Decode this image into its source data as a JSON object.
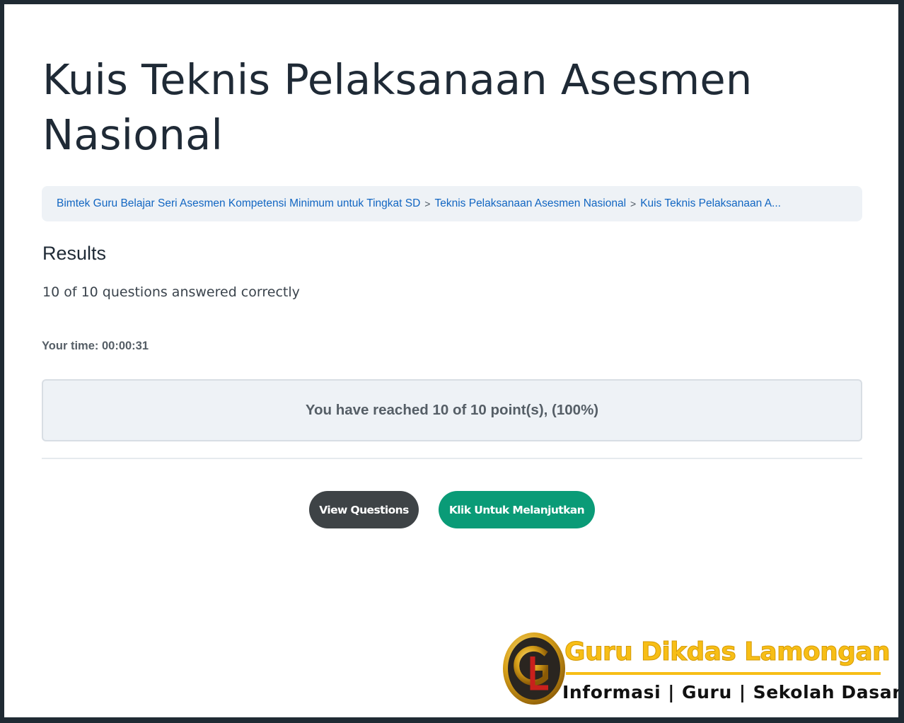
{
  "page": {
    "title": "Kuis Teknis Pelaksanaan Asesmen Nasional"
  },
  "breadcrumb": {
    "separator": ">",
    "items": [
      {
        "label": "Bimtek Guru Belajar Seri Asesmen Kompetensi Minimum untuk Tingkat SD"
      },
      {
        "label": "Teknis Pelaksanaan Asesmen Nasional"
      },
      {
        "label": "Kuis Teknis Pelaksanaan A..."
      }
    ]
  },
  "results": {
    "heading": "Results",
    "summary": "10 of 10 questions answered correctly",
    "time_label": "Your time:",
    "time_value": "00:00:31",
    "points_message": "You have reached 10 of 10 point(s), (100%)"
  },
  "actions": {
    "view_questions_label": "View Questions",
    "continue_label": "Klik Untuk Melanjutkan"
  },
  "watermark": {
    "brand": "Guru Dikdas Lamongan",
    "tagline_parts": [
      "Informasi",
      "Guru",
      "Sekolah Dasar"
    ],
    "tagline_separator": "|",
    "emblem_letters": "GDL"
  },
  "colors": {
    "title_text": "#1f2a36",
    "link": "#1266c2",
    "panel_bg": "#eef2f6",
    "button_dark": "#3e4346",
    "button_green": "#0a9b77",
    "brand_gold": "#f7be16",
    "outer_frame": "#1f2a33"
  }
}
